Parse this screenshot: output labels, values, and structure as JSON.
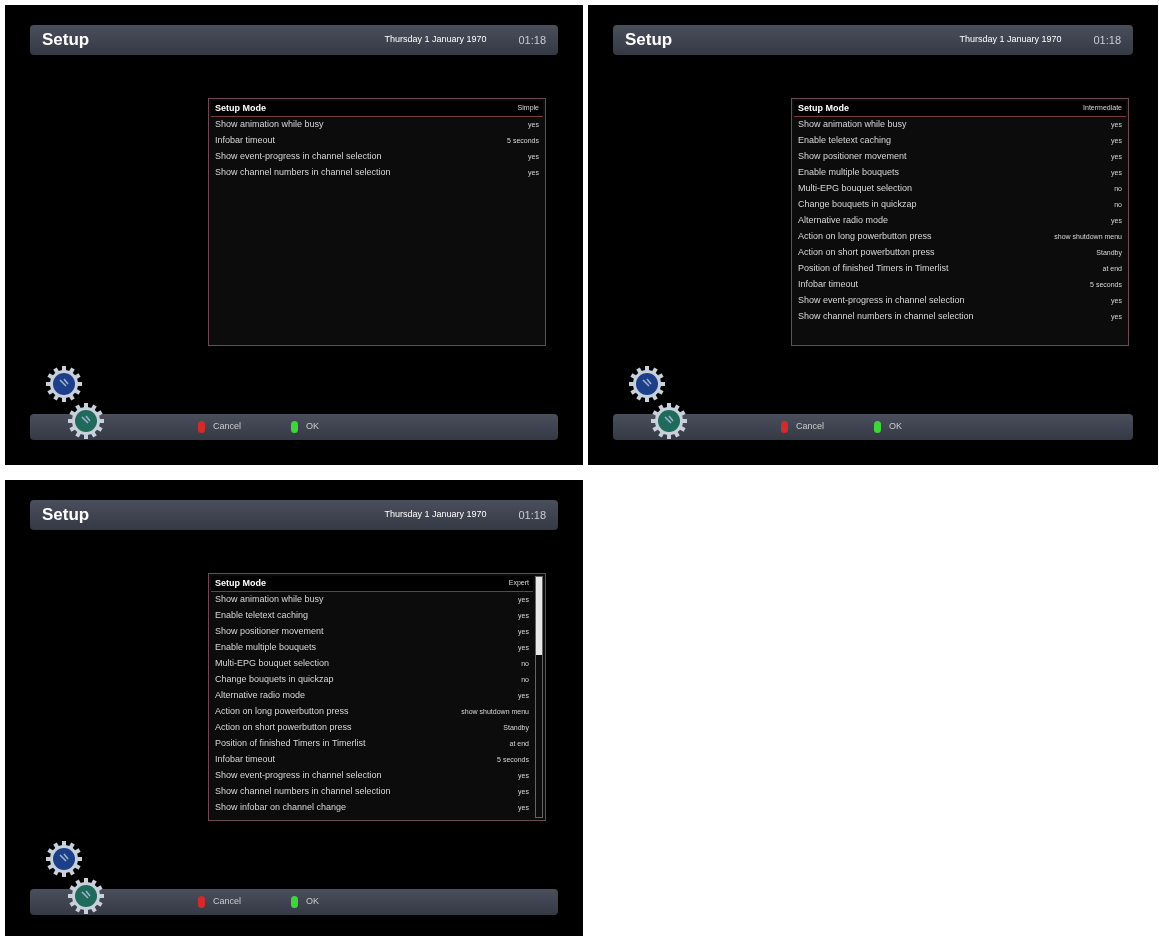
{
  "screens": [
    {
      "title": "Setup",
      "date": "Thursday 1 January 1970",
      "time": "01:18",
      "scrollable": false,
      "rows": [
        {
          "label": "Setup Mode",
          "value": "Simple",
          "selected": true
        },
        {
          "label": "Show animation while busy",
          "value": "yes",
          "selected": false
        },
        {
          "label": "Infobar timeout",
          "value": "5 seconds",
          "selected": false
        },
        {
          "label": "Show event-progress in channel selection",
          "value": "yes",
          "selected": false
        },
        {
          "label": "Show channel numbers in channel selection",
          "value": "yes",
          "selected": false
        }
      ],
      "buttons": [
        {
          "label": "Cancel",
          "color": "#d42a2a"
        },
        {
          "label": "OK",
          "color": "#3fd43a"
        }
      ]
    },
    {
      "title": "Setup",
      "date": "Thursday 1 January 1970",
      "time": "01:18",
      "scrollable": false,
      "rows": [
        {
          "label": "Setup Mode",
          "value": "Intermediate",
          "selected": true
        },
        {
          "label": "Show animation while busy",
          "value": "yes",
          "selected": false
        },
        {
          "label": "Enable teletext caching",
          "value": "yes",
          "selected": false
        },
        {
          "label": "Show positioner movement",
          "value": "yes",
          "selected": false
        },
        {
          "label": "Enable multiple bouquets",
          "value": "yes",
          "selected": false
        },
        {
          "label": "Multi-EPG bouquet selection",
          "value": "no",
          "selected": false
        },
        {
          "label": "Change bouquets in quickzap",
          "value": "no",
          "selected": false
        },
        {
          "label": "Alternative radio mode",
          "value": "yes",
          "selected": false
        },
        {
          "label": "Action on long powerbutton press",
          "value": "show shutdown menu",
          "selected": false
        },
        {
          "label": "Action on short powerbutton press",
          "value": "Standby",
          "selected": false
        },
        {
          "label": "Position of finished Timers in Timerlist",
          "value": "at end",
          "selected": false
        },
        {
          "label": "Infobar timeout",
          "value": "5 seconds",
          "selected": false
        },
        {
          "label": "Show event-progress in channel selection",
          "value": "yes",
          "selected": false
        },
        {
          "label": "Show channel numbers in channel selection",
          "value": "yes",
          "selected": false
        }
      ],
      "buttons": [
        {
          "label": "Cancel",
          "color": "#d42a2a"
        },
        {
          "label": "OK",
          "color": "#3fd43a"
        }
      ]
    },
    {
      "title": "Setup",
      "date": "Thursday 1 January 1970",
      "time": "01:18",
      "scrollable": true,
      "rows": [
        {
          "label": "Setup Mode",
          "value": "Expert",
          "selected": true
        },
        {
          "label": "Show animation while busy",
          "value": "yes",
          "selected": false
        },
        {
          "label": "Enable teletext caching",
          "value": "yes",
          "selected": false
        },
        {
          "label": "Show positioner movement",
          "value": "yes",
          "selected": false
        },
        {
          "label": "Enable multiple bouquets",
          "value": "yes",
          "selected": false
        },
        {
          "label": "Multi-EPG bouquet selection",
          "value": "no",
          "selected": false
        },
        {
          "label": "Change bouquets in quickzap",
          "value": "no",
          "selected": false
        },
        {
          "label": "Alternative radio mode",
          "value": "yes",
          "selected": false
        },
        {
          "label": "Action on long powerbutton press",
          "value": "show shutdown menu",
          "selected": false
        },
        {
          "label": "Action on short powerbutton press",
          "value": "Standby",
          "selected": false
        },
        {
          "label": "Position of finished Timers in Timerlist",
          "value": "at end",
          "selected": false
        },
        {
          "label": "Infobar timeout",
          "value": "5 seconds",
          "selected": false
        },
        {
          "label": "Show event-progress in channel selection",
          "value": "yes",
          "selected": false
        },
        {
          "label": "Show channel numbers in channel selection",
          "value": "yes",
          "selected": false
        },
        {
          "label": "Show infobar on channel change",
          "value": "yes",
          "selected": false
        }
      ],
      "buttons": [
        {
          "label": "Cancel",
          "color": "#d42a2a"
        },
        {
          "label": "OK",
          "color": "#3fd43a"
        }
      ]
    }
  ]
}
